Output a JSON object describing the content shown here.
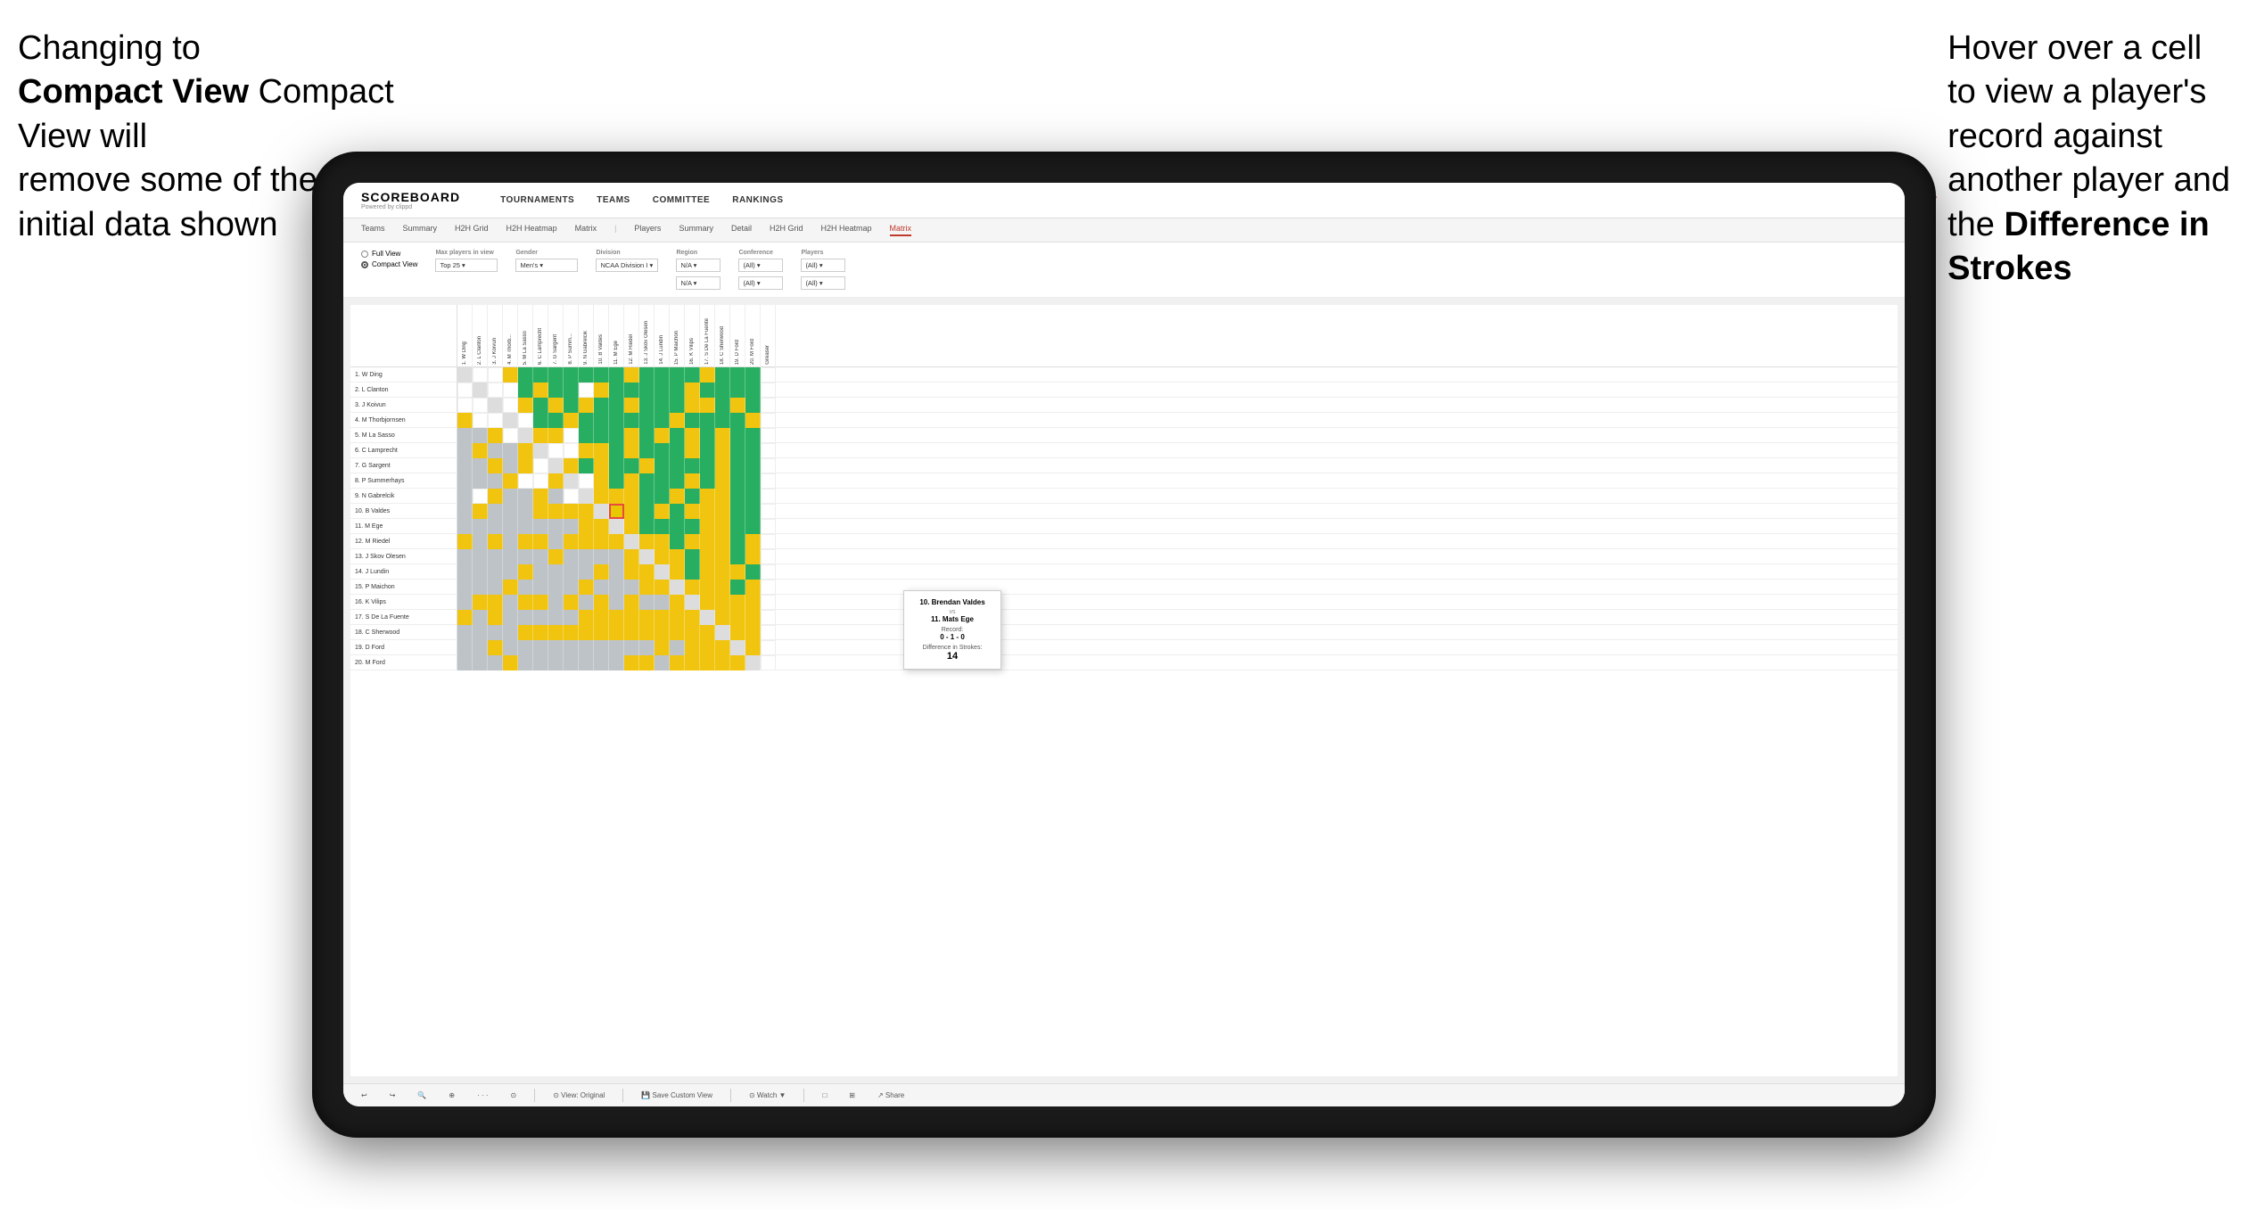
{
  "annotations": {
    "left": {
      "line1": "Changing to",
      "line2": "Compact View will",
      "line3": "remove some of the",
      "line4": "initial data shown"
    },
    "right": {
      "line1": "Hover over a cell",
      "line2": "to view a player's",
      "line3": "record against",
      "line4": "another player and",
      "line5": "the ",
      "bold": "Difference in",
      "bold2": "Strokes"
    }
  },
  "nav": {
    "logo": "SCOREBOARD",
    "logo_sub": "Powered by clippd",
    "items": [
      "TOURNAMENTS",
      "TEAMS",
      "COMMITTEE",
      "RANKINGS"
    ]
  },
  "sub_nav": {
    "items": [
      "Teams",
      "Summary",
      "H2H Grid",
      "H2H Heatmap",
      "Matrix",
      "Players",
      "Summary",
      "Detail",
      "H2H Grid",
      "H2H Heatmap",
      "Matrix"
    ],
    "active": "Matrix"
  },
  "controls": {
    "view_options": [
      "Full View",
      "Compact View"
    ],
    "selected_view": "Compact View",
    "filters": {
      "max_players": {
        "label": "Max players in view",
        "value": "Top 25"
      },
      "gender": {
        "label": "Gender",
        "value": "Men's"
      },
      "division": {
        "label": "Division",
        "value": "NCAA Division I"
      },
      "region": {
        "label": "Region",
        "value": "N/A"
      },
      "conference": {
        "label": "Conference",
        "value": "(All)"
      },
      "players": {
        "label": "Players",
        "value": "(All)"
      }
    }
  },
  "players": [
    "1. W Ding",
    "2. L Clanton",
    "3. J Koivun",
    "4. M Thorbjornsen",
    "5. M La Sasso",
    "6. C Lamprecht",
    "7. G Sargent",
    "8. P Summerhays",
    "9. N Gabrelcik",
    "10. B Valdes",
    "11. M Ege",
    "12. M Riedel",
    "13. J Skov Olesen",
    "14. J Lundin",
    "15. P Maichon",
    "16. K Vilips",
    "17. S De La Fuente",
    "18. C Sherwood",
    "19. D Ford",
    "20. M Ford"
  ],
  "tooltip": {
    "player1": "10. Brendan Valdes",
    "vs": "vs",
    "player2": "11. Mats Ege",
    "record_label": "Record:",
    "record": "0 - 1 - 0",
    "diff_label": "Difference in Strokes:",
    "diff": "14"
  },
  "toolbar": {
    "items": [
      "↩",
      "↪",
      "🔍",
      "⊕",
      "·",
      "⊙",
      "View: Original",
      "Save Custom View",
      "Watch ▼",
      "□",
      "⊞",
      "Share"
    ]
  }
}
